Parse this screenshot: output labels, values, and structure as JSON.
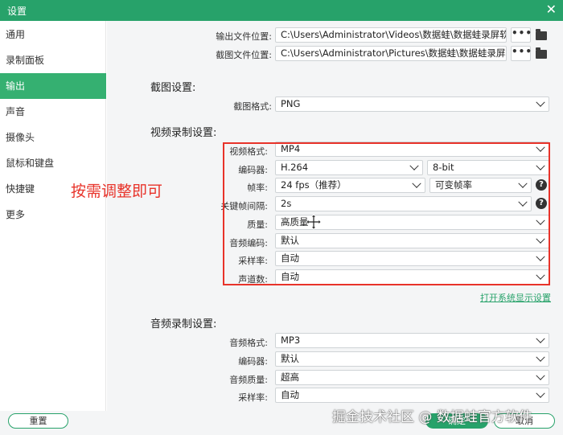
{
  "window": {
    "title": "设置",
    "close_glyph": "✕"
  },
  "sidebar": {
    "items": [
      {
        "label": "通用"
      },
      {
        "label": "录制面板"
      },
      {
        "label": "输出"
      },
      {
        "label": "声音"
      },
      {
        "label": "摄像头"
      },
      {
        "label": "鼠标和键盘"
      },
      {
        "label": "快捷键"
      },
      {
        "label": "更多"
      }
    ],
    "active_index": 2
  },
  "output": {
    "video_path_label": "输出文件位置:",
    "video_path": "C:\\Users\\Administrator\\Videos\\数据蛙\\数据蛙录屏软件",
    "screenshot_path_label": "截图文件位置:",
    "screenshot_path": "C:\\Users\\Administrator\\Pictures\\数据蛙\\数据蛙录屏软件",
    "more_glyph": "•••"
  },
  "screenshot_settings": {
    "title": "截图设置:",
    "format_label": "截图格式:",
    "format_value": "PNG"
  },
  "video_settings": {
    "title": "视频录制设置:",
    "format_label": "视频格式:",
    "format_value": "MP4",
    "encoder_label": "编码器:",
    "encoder_value": "H.264",
    "bitdepth_value": "8-bit",
    "fps_label": "帧率:",
    "fps_value": "24 fps（推荐）",
    "fps_mode_value": "可变帧率",
    "keyframe_label": "关键帧间隔:",
    "keyframe_value": "2s",
    "quality_label": "质量:",
    "quality_value": "高质量",
    "audio_codec_label": "音频编码:",
    "audio_codec_value": "默认",
    "samplerate_label": "采样率:",
    "samplerate_value": "自动",
    "channels_label": "声道数:",
    "channels_value": "自动",
    "help_glyph": "?"
  },
  "annotation": {
    "text": "按需调整即可",
    "color": "#e8332a"
  },
  "system_display_link": "打开系统显示设置",
  "audio_settings": {
    "title": "音频录制设置:",
    "format_label": "音频格式:",
    "format_value": "MP3",
    "encoder_label": "编码器:",
    "encoder_value": "默认",
    "quality_label": "音频质量:",
    "quality_value": "超高",
    "samplerate_label": "采样率:",
    "samplerate_value": "自动"
  },
  "footer": {
    "reset_label": "重置",
    "ok_label": "确定",
    "cancel_label": "取消"
  },
  "watermark": "掘金技术社区 @ 数据蛙官方软件",
  "colors": {
    "accent": "#27a26a",
    "active_item": "#35b071",
    "annotation_red": "#e8332a"
  }
}
